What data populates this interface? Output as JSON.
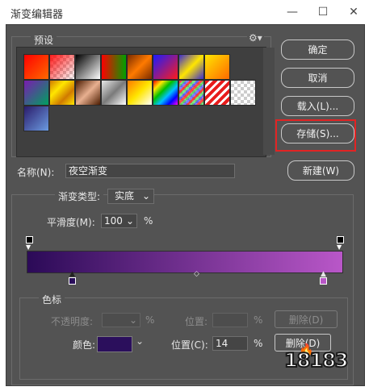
{
  "window": {
    "title": "渐变编辑器",
    "minimize_glyph": "—",
    "maximize_glyph": "☐",
    "close_glyph": "✕"
  },
  "presets": {
    "label": "预设",
    "menu_icon": "gear-icon"
  },
  "buttons": {
    "ok": "确定",
    "cancel": "取消",
    "load": "载入(L)...",
    "save": "存储(S)...",
    "new": "新建(W)"
  },
  "name": {
    "label": "名称(N):",
    "value": "夜空渐变"
  },
  "gradient_type": {
    "label": "渐变类型:",
    "value": "实底"
  },
  "smoothness": {
    "label": "平滑度(M):",
    "value": "100",
    "unit": "%"
  },
  "gradient": {
    "start_color": "#2b0a57",
    "end_color": "#b957c8"
  },
  "color_stops": {
    "group_label": "色标",
    "opacity_label": "不透明度:",
    "opacity_unit": "%",
    "opacity_location_label": "位置:",
    "opacity_location_unit": "%",
    "opacity_delete": "删除(D)",
    "color_label": "颜色:",
    "color_value": "#2b0f5c",
    "location_label": "位置(C):",
    "location_value": "14",
    "location_unit": "%",
    "color_delete": "删除(D)"
  },
  "watermark": {
    "text": "18183"
  }
}
